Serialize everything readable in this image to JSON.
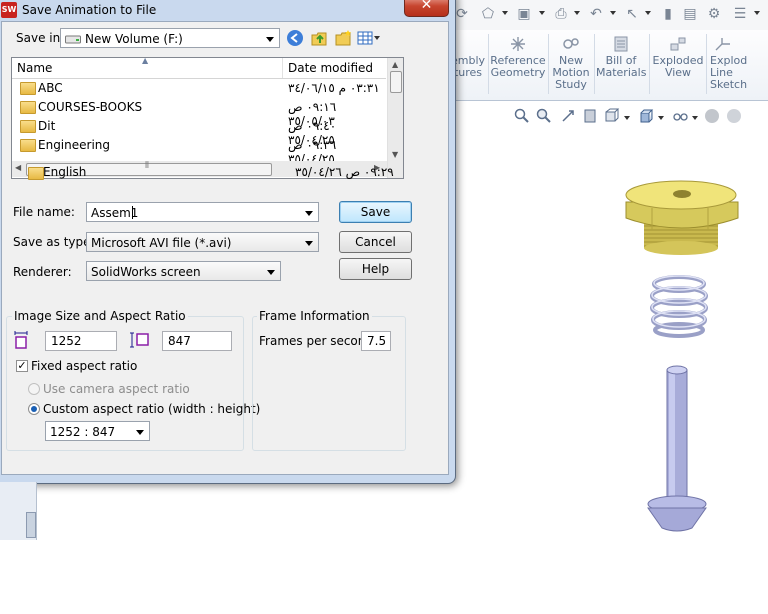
{
  "dialog": {
    "title": "Save Animation to File",
    "close_glyph": "✕",
    "save_in_label": "Save in:",
    "save_in_value": "New Volume (F:)",
    "list": {
      "columns": [
        "Name",
        "Date modified"
      ],
      "rows": [
        {
          "name": "ABC",
          "date": "٠٣:٣١ م ٣٤/٠٦/١٥"
        },
        {
          "name": "COURSES-BOOKS",
          "date": "٠٩:١٦ ص ٣٥/٠٥/٠٣"
        },
        {
          "name": "Dit",
          "date": "٠٩:٤٠ ص ٣٥/٠٤/٢٥"
        },
        {
          "name": "Engineering",
          "date": "٠٩:٣٦ ص ٣٥/٠٤/٢٥"
        },
        {
          "name": "English",
          "date": "٠٩:٢٩ ص ٣٥/٠٤/٢٦"
        }
      ]
    },
    "file_name_label": "File name:",
    "file_name_value": "Assem1",
    "save_as_type_label": "Save as type:",
    "save_as_type_value": "Microsoft AVI file (*.avi)",
    "renderer_label": "Renderer:",
    "renderer_value": "SolidWorks screen",
    "buttons": {
      "save": "Save",
      "cancel": "Cancel",
      "help": "Help"
    },
    "image_size": {
      "group_title": "Image Size and Aspect Ratio",
      "width": "1252",
      "height": "847",
      "fixed_aspect_label": "Fixed aspect ratio",
      "fixed_aspect_checked": true,
      "camera_aspect_label": "Use camera aspect ratio",
      "custom_aspect_label": "Custom aspect ratio (width : height)",
      "custom_aspect_value": "1252 : 847"
    },
    "frame_info": {
      "group_title": "Frame Information",
      "fps_label": "Frames per second",
      "fps_value": "7.5"
    }
  },
  "ribbon": {
    "items": [
      {
        "label": "embly\ntures"
      },
      {
        "label": "Reference\nGeometry"
      },
      {
        "label": "New\nMotion\nStudy"
      },
      {
        "label": "Bill of\nMaterials"
      },
      {
        "label": "Exploded\nView"
      },
      {
        "label": "Explod\nLine\nSketch"
      }
    ]
  },
  "colors": {
    "accent": "#3c7fb1",
    "part_yellow": "#e8dc6a",
    "part_blue": "#b8bde8"
  }
}
